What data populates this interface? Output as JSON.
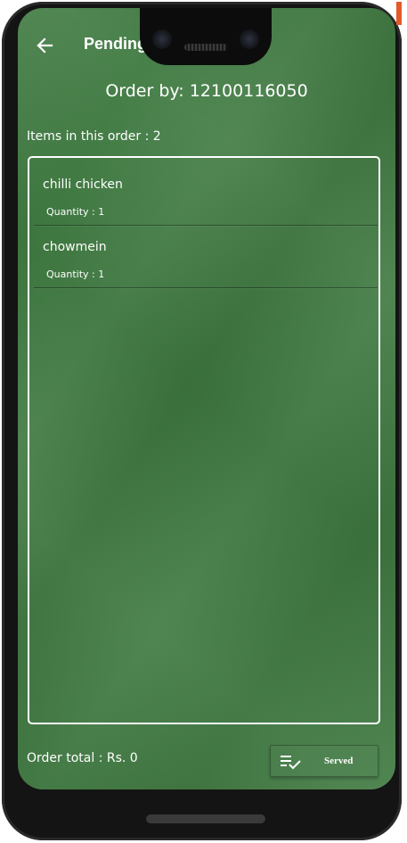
{
  "header": {
    "title": "Pending"
  },
  "order": {
    "by_label": "Order by: 12100116050",
    "items_count_label": "Items in this order : 2",
    "items": [
      {
        "name": "chilli chicken",
        "quantity_label": "Quantity : 1"
      },
      {
        "name": "chowmein",
        "quantity_label": "Quantity : 1"
      }
    ],
    "total_label": "Order total : Rs. 0"
  },
  "actions": {
    "served_label": "Served"
  },
  "icons": {
    "back": "arrow-left-icon",
    "served": "playlist-check-icon"
  },
  "colors": {
    "background": "#3f7a41",
    "text": "#ffffff",
    "frame": "#141414"
  }
}
